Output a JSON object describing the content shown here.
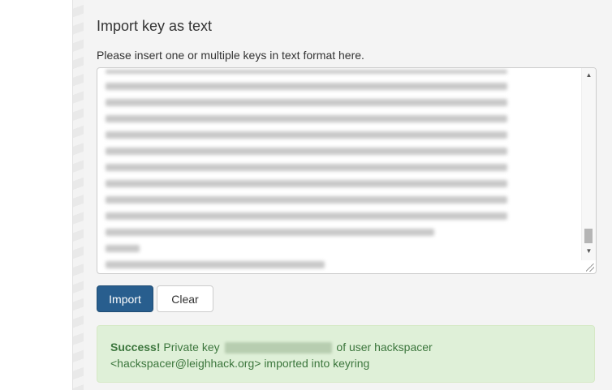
{
  "section": {
    "title": "Import key as text",
    "instruction": "Please insert one or multiple keys in text format here."
  },
  "buttons": {
    "import_label": "Import",
    "clear_label": "Clear"
  },
  "alert": {
    "strong": "Success!",
    "text_before_key": " Private key ",
    "text_after_key": " of user hackspacer",
    "text_line2": "<hackspacer@leighhack.org> imported into keyring"
  },
  "colors": {
    "primary_button": "#285e8e",
    "alert_bg": "#dff0d8",
    "alert_text": "#3c763d"
  },
  "icons": {
    "scroll_up": "triangle-up",
    "scroll_down": "triangle-down",
    "resize": "resize-grip"
  }
}
